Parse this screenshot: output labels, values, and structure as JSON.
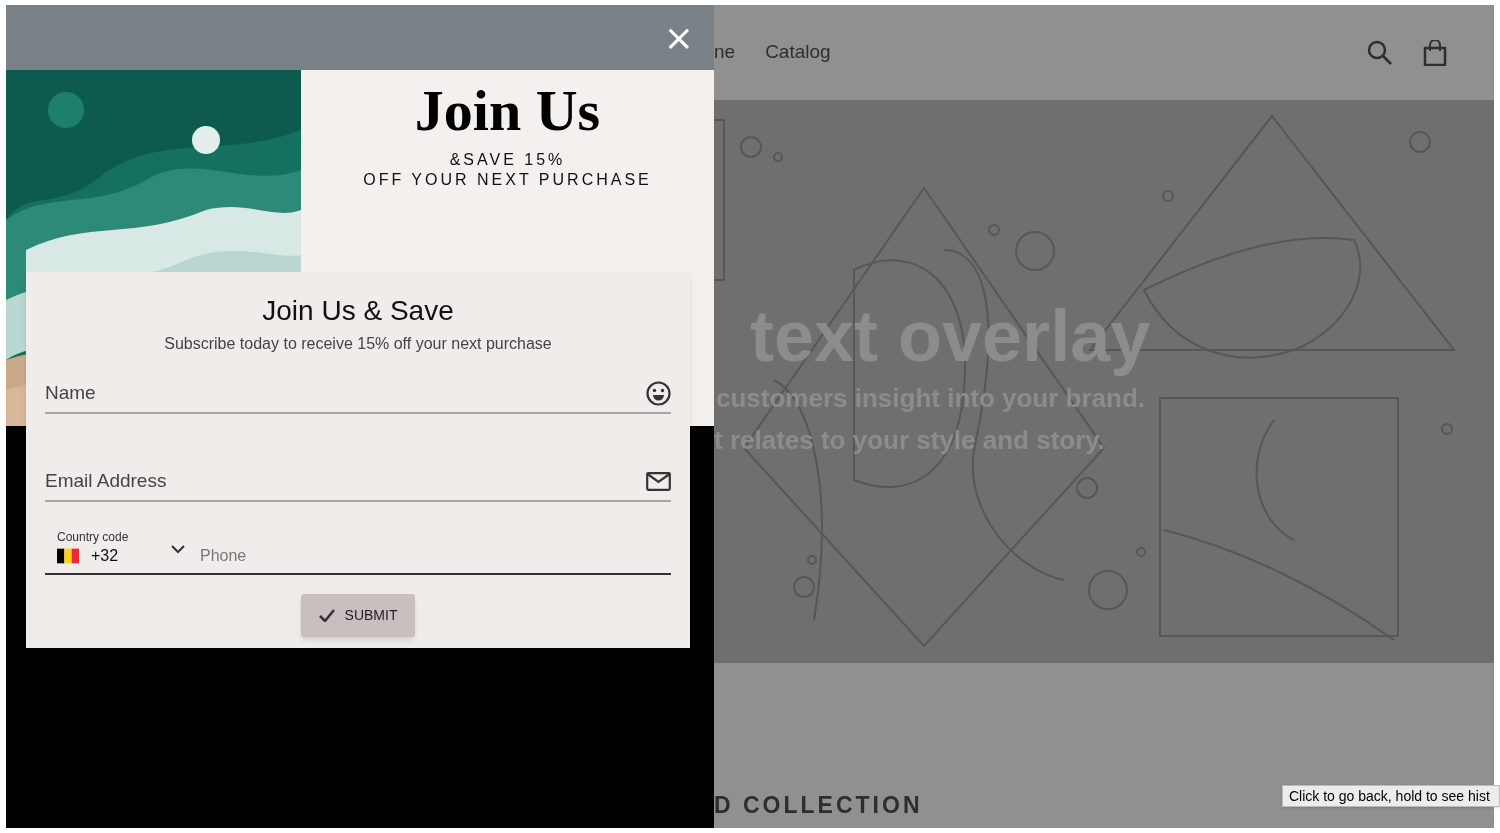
{
  "popup": {
    "close": "×",
    "headline": "Join Us",
    "tagline_lines": [
      "&SAVE 15%",
      "OFF YOUR NEXT PURCHASE"
    ],
    "form": {
      "title": "Join Us & Save",
      "subtitle": "Subscribe today to receive 15% off your next purchase",
      "fields": [
        {
          "kind": "text",
          "placeholder": "Name"
        },
        {
          "kind": "email",
          "placeholder": "Email Address"
        }
      ],
      "phone": {
        "country_label": "Country code",
        "dial_code": "+32",
        "placeholder": "Phone"
      },
      "submit": "SUBMIT"
    }
  },
  "store": {
    "nav": [
      "ne",
      "Catalog"
    ],
    "hero": {
      "title": "text overlay",
      "lines": [
        "customers insight into your brand.",
        "t relates to your style and story."
      ]
    },
    "section_heading": "D COLLECTION"
  },
  "tooltip": "Click to go back, hold to see hist"
}
